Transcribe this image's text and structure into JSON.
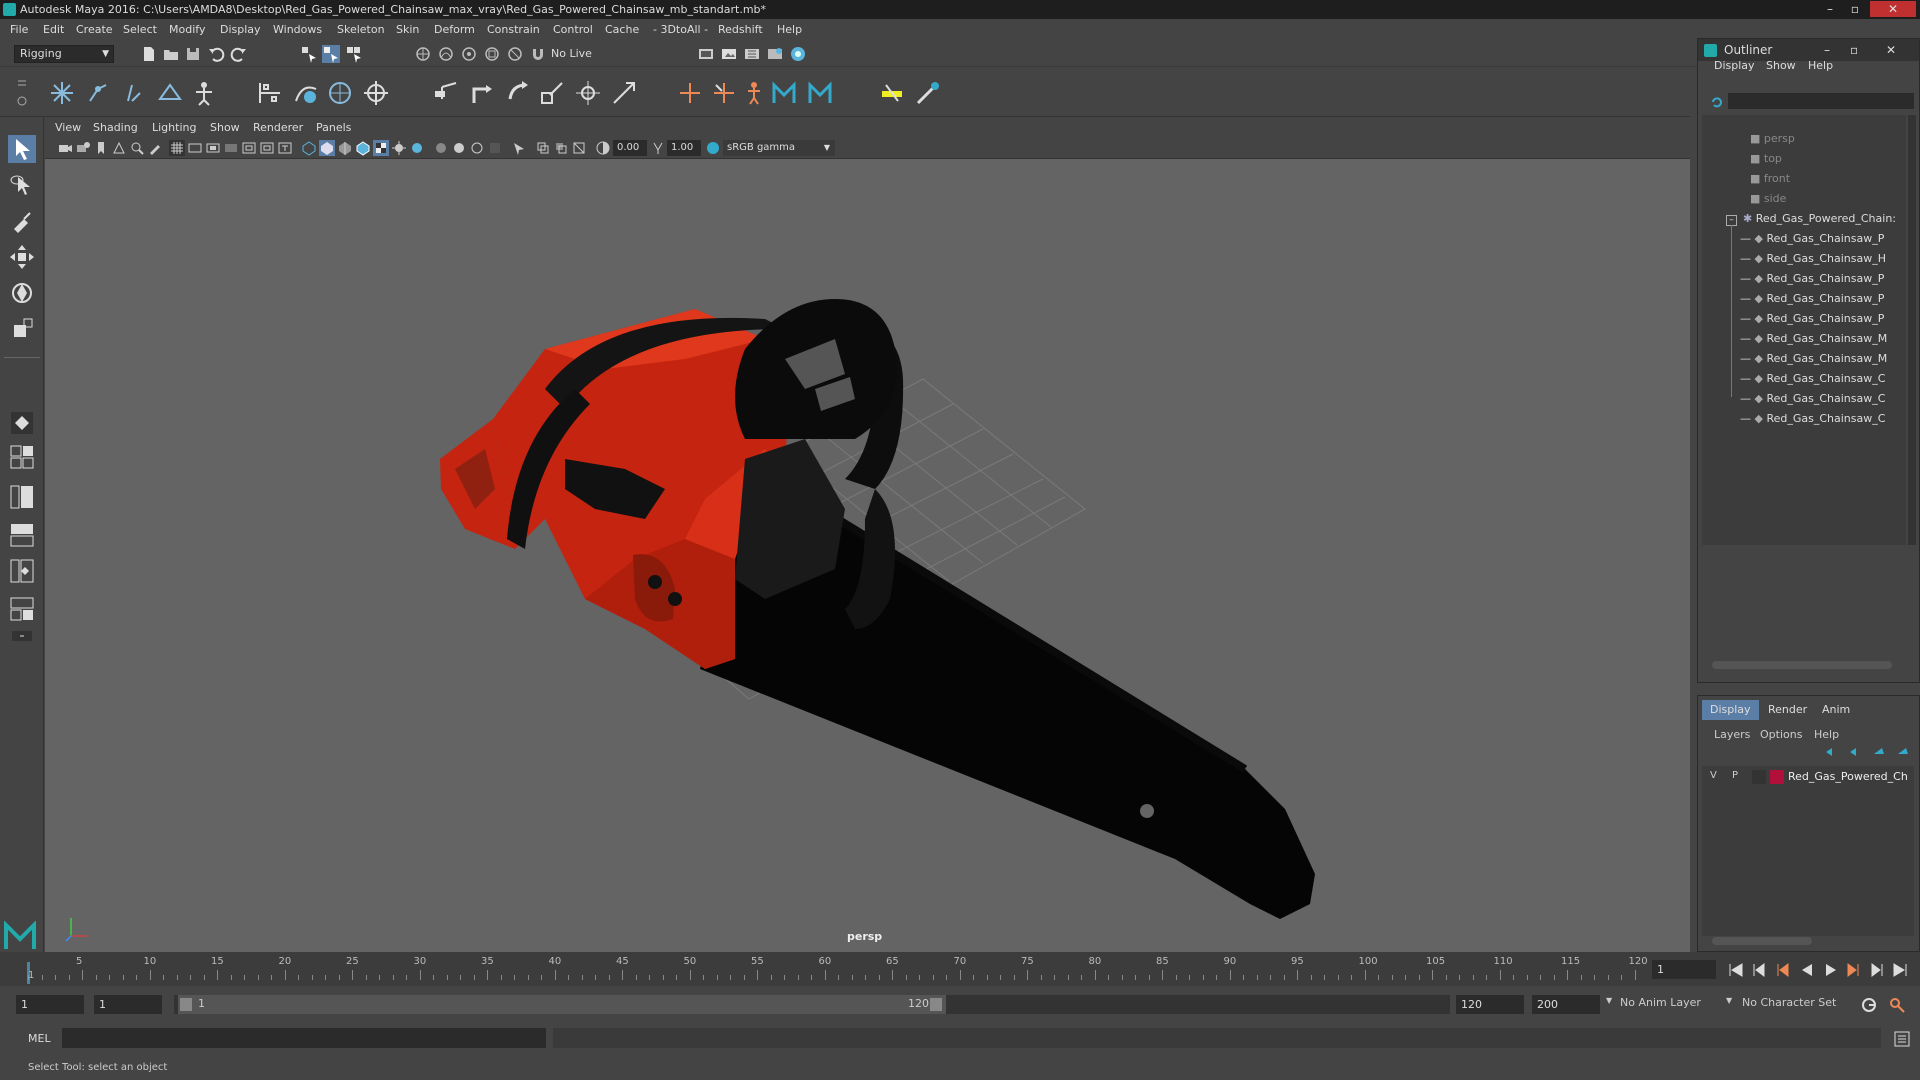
{
  "window": {
    "title": "Autodesk Maya 2016: C:\\Users\\AMDA8\\Desktop\\Red_Gas_Powered_Chainsaw_max_vray\\Red_Gas_Powered_Chainsaw_mb_standart.mb*"
  },
  "menubar": [
    "File",
    "Edit",
    "Create",
    "Select",
    "Modify",
    "Display",
    "Windows",
    "Skeleton",
    "Skin",
    "Deform",
    "Constrain",
    "Control",
    "Cache",
    "- 3DtoAll -",
    "Redshift",
    "Help"
  ],
  "statusline": {
    "mode": "Rigging",
    "live_surface": "No Live Surface"
  },
  "panel": {
    "menus": [
      "View",
      "Shading",
      "Lighting",
      "Show",
      "Renderer",
      "Panels"
    ],
    "exposure": "0.00",
    "gamma": "1.00",
    "color_space": "sRGB gamma",
    "camera_label": "persp"
  },
  "outliner": {
    "title": "Outliner",
    "menus": [
      "Display",
      "Show",
      "Help"
    ],
    "cameras": [
      "persp",
      "top",
      "front",
      "side"
    ],
    "group": "Red_Gas_Powered_Chain:",
    "children": [
      "Red_Gas_Chainsaw_P",
      "Red_Gas_Chainsaw_H",
      "Red_Gas_Chainsaw_P",
      "Red_Gas_Chainsaw_P",
      "Red_Gas_Chainsaw_P",
      "Red_Gas_Chainsaw_M",
      "Red_Gas_Chainsaw_M",
      "Red_Gas_Chainsaw_C",
      "Red_Gas_Chainsaw_C",
      "Red_Gas_Chainsaw_C"
    ]
  },
  "layer_editor": {
    "tabs": [
      "Display",
      "Render",
      "Anim"
    ],
    "menus": [
      "Layers",
      "Options",
      "Help"
    ],
    "layer": {
      "v": "V",
      "p": "P",
      "name": "Red_Gas_Powered_Ch",
      "color": "#b0103a"
    }
  },
  "timeline": {
    "ticks": [
      "5",
      "10",
      "15",
      "20",
      "25",
      "30",
      "35",
      "40",
      "45",
      "50",
      "55",
      "60",
      "65",
      "70",
      "75",
      "80",
      "85",
      "90",
      "95",
      "100",
      "105",
      "110",
      "115",
      "120"
    ],
    "start_tick": "1",
    "current_frame": "1"
  },
  "range": {
    "start": "1",
    "playback_start": "1",
    "slider_start": "1",
    "slider_end": "120",
    "playback_end": "120",
    "end": "200",
    "anim_layer": "No Anim Layer",
    "character_set": "No Character Set"
  },
  "command": {
    "label": "MEL"
  },
  "help": {
    "text": "Select Tool: select an object"
  },
  "colors": {
    "accent": "#5ab4dc",
    "body_red": "#d42a10",
    "layer": "#b0103a"
  }
}
